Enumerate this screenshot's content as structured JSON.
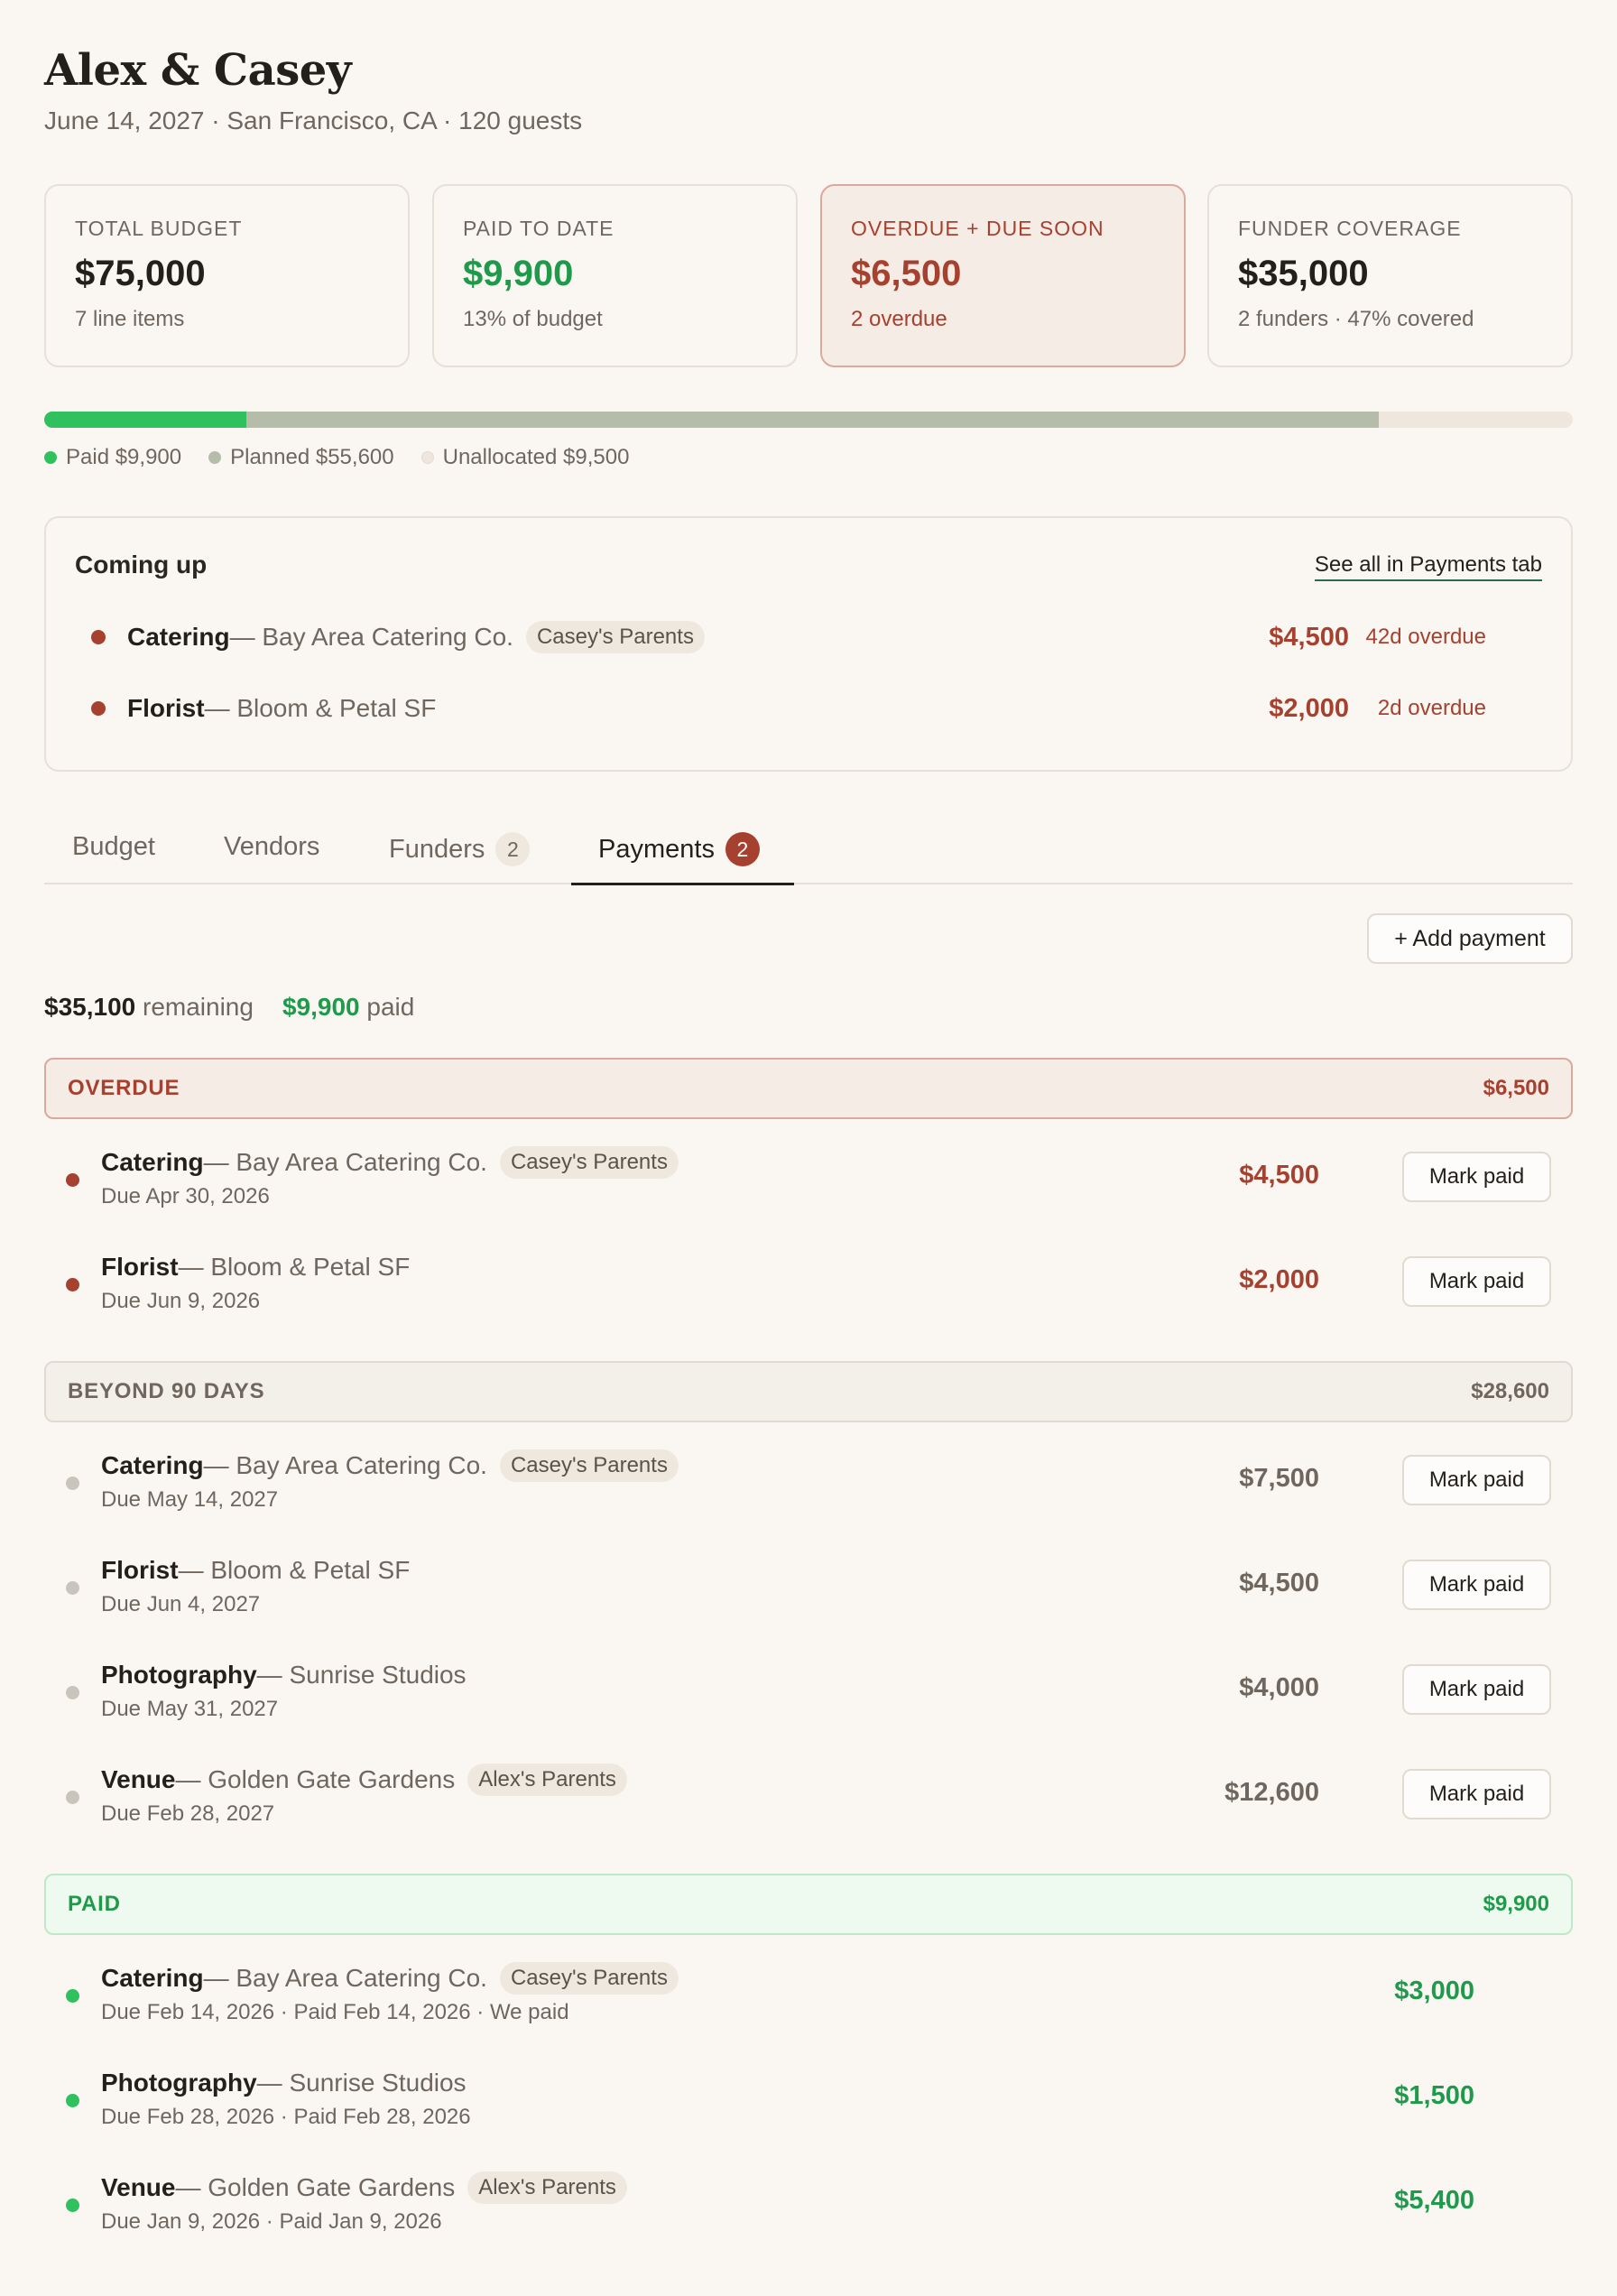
{
  "header": {
    "title": "Alex & Casey",
    "subtitle": "June 14, 2027 · San Francisco, CA · 120 guests"
  },
  "stats": [
    {
      "label": "TOTAL BUDGET",
      "value": "$75,000",
      "note": "7 line items"
    },
    {
      "label": "PAID TO DATE",
      "value": "$9,900",
      "note": "13% of budget"
    },
    {
      "label": "OVERDUE + DUE SOON",
      "value": "$6,500",
      "note": "2 overdue"
    },
    {
      "label": "FUNDER COVERAGE",
      "value": "$35,000",
      "note": "2 funders · 47% covered"
    }
  ],
  "budget_bar": {
    "total": 75000,
    "paid": 9900,
    "planned": 55600,
    "unallocated": 9500,
    "legend": {
      "paid": "Paid $9,900",
      "planned": "Planned $55,600",
      "unallocated": "Unallocated $9,500"
    }
  },
  "colors": {
    "paid": "#2fc15d",
    "planned": "#b5bdaa",
    "unallocated": "#efe7dd",
    "overdue": "#a6412f",
    "upcoming_dot": "#c9c4bc"
  },
  "coming_up": {
    "title": "Coming up",
    "see_all": "See all in Payments tab",
    "items": [
      {
        "category": "Catering",
        "vendor": " — Bay Area Catering Co.",
        "badge": "Casey's Parents",
        "amount": "$4,500",
        "status": "42d overdue"
      },
      {
        "category": "Florist",
        "vendor": " — Bloom & Petal SF",
        "badge": "",
        "amount": "$2,000",
        "status": "2d overdue"
      }
    ]
  },
  "tabs": [
    {
      "label": "Budget",
      "count": ""
    },
    {
      "label": "Vendors",
      "count": ""
    },
    {
      "label": "Funders",
      "count": "2"
    },
    {
      "label": "Payments",
      "count": "2"
    }
  ],
  "payments": {
    "add_label": "+ Add payment",
    "remaining_amount": "$35,100",
    "remaining_label": " remaining",
    "paid_amount": "$9,900",
    "paid_label": " paid",
    "mark_paid_label": "Mark paid",
    "sections": {
      "overdue": {
        "title": "OVERDUE",
        "total": "$6,500",
        "rows": [
          {
            "category": "Catering",
            "vendor": " — Bay Area Catering Co.",
            "badge": "Casey's Parents",
            "due": "Due Apr 30, 2026",
            "amount": "$4,500"
          },
          {
            "category": "Florist",
            "vendor": " — Bloom & Petal SF",
            "badge": "",
            "due": "Due Jun 9, 2026",
            "amount": "$2,000"
          }
        ]
      },
      "beyond": {
        "title": "BEYOND 90 DAYS",
        "total": "$28,600",
        "rows": [
          {
            "category": "Catering",
            "vendor": " — Bay Area Catering Co.",
            "badge": "Casey's Parents",
            "due": "Due May 14, 2027",
            "amount": "$7,500"
          },
          {
            "category": "Florist",
            "vendor": " — Bloom & Petal SF",
            "badge": "",
            "due": "Due Jun 4, 2027",
            "amount": "$4,500"
          },
          {
            "category": "Photography",
            "vendor": " — Sunrise Studios",
            "badge": "",
            "due": "Due May 31, 2027",
            "amount": "$4,000"
          },
          {
            "category": "Venue",
            "vendor": " — Golden Gate Gardens",
            "badge": "Alex's Parents",
            "due": "Due Feb 28, 2027",
            "amount": "$12,600"
          }
        ]
      },
      "paid": {
        "title": "PAID",
        "total": "$9,900",
        "rows": [
          {
            "category": "Catering",
            "vendor": " — Bay Area Catering Co.",
            "badge": "Casey's Parents",
            "due": "Due Feb 14, 2026 · Paid Feb 14, 2026 · We paid",
            "amount": "$3,000"
          },
          {
            "category": "Photography",
            "vendor": " — Sunrise Studios",
            "badge": "",
            "due": "Due Feb 28, 2026 · Paid Feb 28, 2026",
            "amount": "$1,500"
          },
          {
            "category": "Venue",
            "vendor": " — Golden Gate Gardens",
            "badge": "Alex's Parents",
            "due": "Due Jan 9, 2026 · Paid Jan 9, 2026",
            "amount": "$5,400"
          }
        ]
      }
    }
  }
}
